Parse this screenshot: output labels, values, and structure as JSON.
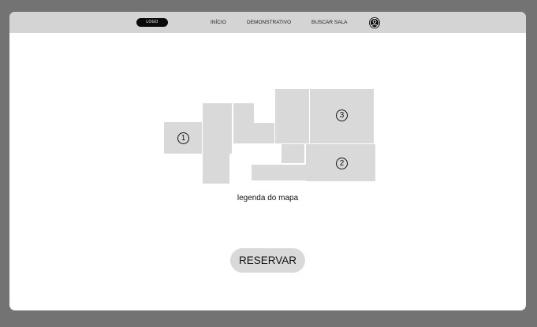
{
  "header": {
    "logo_label": "LOGO",
    "nav": {
      "inicio": "INÍCIO",
      "demonstrativo": "DEMONSTRATIVO",
      "buscar_sala": "BUSCAR SALA"
    },
    "profile_icon": "user-circle-icon"
  },
  "map": {
    "rooms": {
      "room1": "1",
      "room2": "2",
      "room3": "3"
    },
    "legend": "legenda do mapa"
  },
  "actions": {
    "reserve_label": "RESERVAR"
  },
  "colors": {
    "background": "#737373",
    "topbar": "#d4d4d4",
    "map_fill": "#d9d9d9",
    "logo": "#0a0a0a"
  }
}
